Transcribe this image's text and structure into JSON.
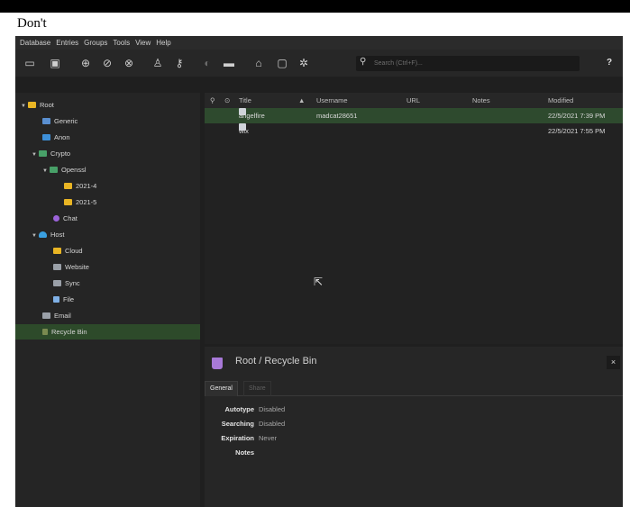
{
  "caption": "Don't",
  "menu": [
    "Database",
    "Entries",
    "Groups",
    "Tools",
    "View",
    "Help"
  ],
  "toolbar": {
    "search_placeholder": "Search (Ctrl+F)...",
    "help_label": "?",
    "search_icon": "search-icon"
  },
  "tree": [
    {
      "label": "Root",
      "icon": "folder-icon",
      "expanded": true
    },
    {
      "label": "Generic",
      "icon": "monitor-icon"
    },
    {
      "label": "Anon",
      "icon": "square-icon"
    },
    {
      "label": "Crypto",
      "icon": "folder-icon",
      "expanded": true
    },
    {
      "label": "Openssl",
      "icon": "folder-icon",
      "expanded": true
    },
    {
      "label": "2021-4",
      "icon": "folder-icon"
    },
    {
      "label": "2021-5",
      "icon": "folder-icon"
    },
    {
      "label": "Chat",
      "icon": "chat-icon"
    },
    {
      "label": "Host",
      "icon": "cloud-icon",
      "expanded": true
    },
    {
      "label": "Cloud",
      "icon": "folder-icon"
    },
    {
      "label": "Website",
      "icon": "website-icon"
    },
    {
      "label": "Sync",
      "icon": "sync-icon"
    },
    {
      "label": "File",
      "icon": "file-icon"
    },
    {
      "label": "Email",
      "icon": "email-icon"
    },
    {
      "label": "Recycle Bin",
      "icon": "recycle-bin-icon",
      "selected": true
    }
  ],
  "columns": {
    "title": "Title",
    "username": "Username",
    "url": "URL",
    "notes": "Notes",
    "modified": "Modified"
  },
  "entries": [
    {
      "title": "angelfire",
      "username": "madcat28651",
      "url": "",
      "notes": "",
      "modified": "22/5/2021 7:39 PM",
      "selected": true
    },
    {
      "title": "wix",
      "username": "",
      "url": "",
      "notes": "",
      "modified": "22/5/2021 7:55 PM"
    }
  ],
  "details": {
    "path": "Root / Recycle Bin",
    "close_label": "×",
    "tabs": [
      "General",
      "Share"
    ],
    "props": [
      {
        "label": "Autotype",
        "value": "Disabled"
      },
      {
        "label": "Searching",
        "value": "Disabled"
      },
      {
        "label": "Expiration",
        "value": "Never"
      },
      {
        "label": "Notes",
        "value": ""
      }
    ]
  },
  "colors": {
    "selection": "#2d4a2a",
    "background": "#1f1f1f",
    "folder": "#e9b524"
  }
}
